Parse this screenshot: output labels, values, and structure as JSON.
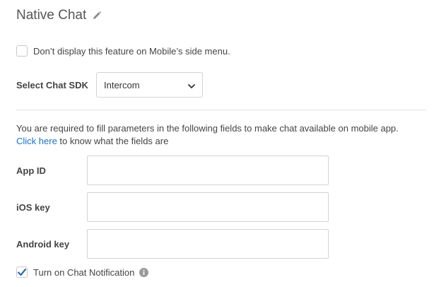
{
  "header": {
    "title": "Native Chat",
    "edit_icon": "pencil-icon"
  },
  "mobile_menu_option": {
    "label": "Don’t display this feature on Mobile’s side menu.",
    "checked": false
  },
  "sdk": {
    "label": "Select Chat SDK",
    "selected": "Intercom",
    "dropdown_icon": "chevron-down-icon"
  },
  "instructions": {
    "text": "You are required to fill parameters in the following fields to make chat available on mobile app.",
    "link_text": "Click here",
    "link_suffix": " to know what the fields are"
  },
  "fields": [
    {
      "label": "App ID",
      "value": ""
    },
    {
      "label": "iOS key",
      "value": ""
    },
    {
      "label": "Android key",
      "value": ""
    }
  ],
  "notification_option": {
    "label": "Turn on Chat Notification",
    "checked": true,
    "info_icon": "info-icon"
  },
  "colors": {
    "link": "#1a73c7",
    "checkbox_checked": "#2b6cb0",
    "text": "#444444"
  }
}
